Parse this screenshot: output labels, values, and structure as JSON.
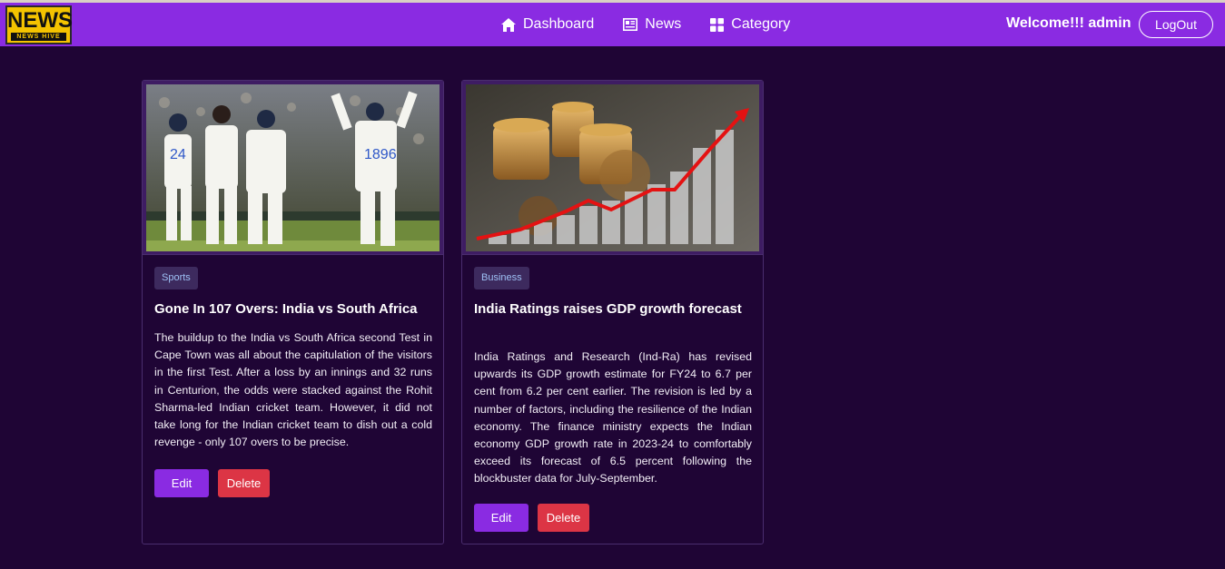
{
  "navbar": {
    "logo_main": "NEWS",
    "logo_sub": "NEWS HIVE",
    "links": [
      {
        "label": "Dashboard",
        "icon": "home-icon"
      },
      {
        "label": "News",
        "icon": "newspaper-icon"
      },
      {
        "label": "Category",
        "icon": "grid-icon"
      }
    ],
    "welcome": "Welcome!!! admin",
    "logout": "LogOut"
  },
  "colors": {
    "navbar_bg": "#8a2be2",
    "page_bg": "#1f0535",
    "edit_button": "#8a2be2",
    "delete_button": "#dc3545"
  },
  "cards": [
    {
      "category": "Sports",
      "title": "Gone In 107 Overs: India vs South Africa",
      "body": "The buildup to the India vs South Africa second Test in Cape Town was all about the capitulation of the visitors in the first Test. After a loss by an innings and 32 runs in Centurion, the odds were stacked against the Rohit Sharma-led Indian cricket team. However, it did not take long for the Indian cricket team to dish out a cold revenge - only 107 overs to be precise.",
      "edit": "Edit",
      "delete": "Delete",
      "image": "cricket-team-celebration-photo"
    },
    {
      "category": "Business",
      "title": "India Ratings raises GDP growth forecast",
      "body": "India Ratings and Research (Ind-Ra) has revised upwards its GDP growth estimate for FY24 to 6.7 per cent from 6.2 per cent earlier. The revision is led by a number of factors, including the resilience of the Indian economy. The finance ministry expects the Indian economy GDP growth rate in 2023-24 to comfortably exceed its forecast of 6.5 percent following the blockbuster data for July-September.",
      "edit": "Edit",
      "delete": "Delete",
      "image": "coins-growth-chart-photo"
    }
  ]
}
